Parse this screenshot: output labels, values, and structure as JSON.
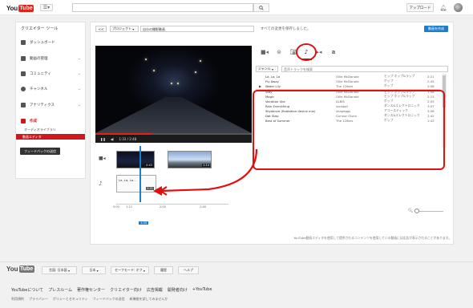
{
  "masthead": {
    "logo_you": "You",
    "logo_tube": "Tube",
    "search_placeholder": "",
    "upload_label": "アップロード"
  },
  "sidebar": {
    "title": "クリエイター ツール",
    "items": [
      {
        "label": "ダッシュボード"
      },
      {
        "label": "動画の管理"
      },
      {
        "label": "コミュニティ"
      },
      {
        "label": "チャンネル"
      },
      {
        "label": "アナリティクス"
      },
      {
        "label": "作成"
      }
    ],
    "sub_items": [
      {
        "label": "オーディオライブラリ"
      },
      {
        "label": "動画エディタ"
      }
    ],
    "feedback_label": "フィードバックの送信"
  },
  "editor": {
    "back_label": "<<",
    "project_label": "プロジェクト",
    "project_title": "自分の撮影動画",
    "save_status": "すべての変更を保存しました。",
    "create_label": "動画を作成",
    "current_time": "1:33",
    "total_time": "2:48"
  },
  "audio": {
    "genre_label": "ジャンル",
    "search_placeholder": "音声トラックを検索",
    "tracks": [
      {
        "title": "La, La, La",
        "artist": "Ollie McDonald",
        "genre": "ヒップ ホップ&ラップ",
        "duration": "2:21"
      },
      {
        "title": "Fly Away",
        "artist": "Ollie McDonald",
        "genre": "ポップ",
        "duration": "2:45"
      },
      {
        "title": "Water Lily",
        "artist": "The 126ers",
        "genre": "ポップ",
        "duration": "2:58"
      },
      {
        "title": "Stay",
        "artist": "Ollie McDonald",
        "genre": "ヒップ ホップ&ラップ",
        "duration": "1:58"
      },
      {
        "title": "Magic",
        "artist": "Ollie McDonald",
        "genre": "ヒップ ホップ&ラップ",
        "duration": "2:13"
      },
      {
        "title": "Vacation Uke",
        "artist": "ALBIS",
        "genre": "ポップ",
        "duration": "2:03"
      },
      {
        "title": "Rain Everything",
        "artist": "sunspot",
        "genre": "ダンス&エレクトロニック",
        "duration": "3:07"
      },
      {
        "title": "Skydance (floatation device mix)",
        "artist": "shapeggs",
        "genre": "アコースティック",
        "duration": "3:56"
      },
      {
        "title": "Dat Step",
        "artist": "Gunnar Olsen",
        "genre": "ダンス&エレクトロニック",
        "duration": "2:42"
      },
      {
        "title": "Best of Summer",
        "artist": "The 126ers",
        "genre": "ポップ",
        "duration": "1:43"
      }
    ]
  },
  "timeline": {
    "clip1_duration": "0:43",
    "clip2_duration": "1:14",
    "audio_clip_label": "La, La, La...",
    "audio_clip_duration": "2:21",
    "ruler": [
      "0:00",
      "1:12",
      "1:33",
      "2:00",
      "2:48"
    ]
  },
  "notice": "YouTube動画エディタを使用して提供されるコンテンツを使用している動画には広告が表示されることがあります。",
  "footer": {
    "language": "言語: 日本語",
    "country": "日本",
    "safety": "セーフモード: オフ",
    "history": "履歴",
    "help": "ヘルプ",
    "links": [
      "YouTubeについて",
      "プレスルーム",
      "著作権センター",
      "クリエイター向け",
      "広告掲載",
      "開発者向け",
      "+YouTube"
    ],
    "links2": [
      "利用規約",
      "プライバシー",
      "ポリシーとセキュリティ",
      "フィードバックの送信",
      "新機能を試してみませんか"
    ]
  },
  "colors": {
    "accent_red": "#e62117",
    "annotation_red": "#e01010",
    "accent_blue": "#1b7fcc"
  }
}
